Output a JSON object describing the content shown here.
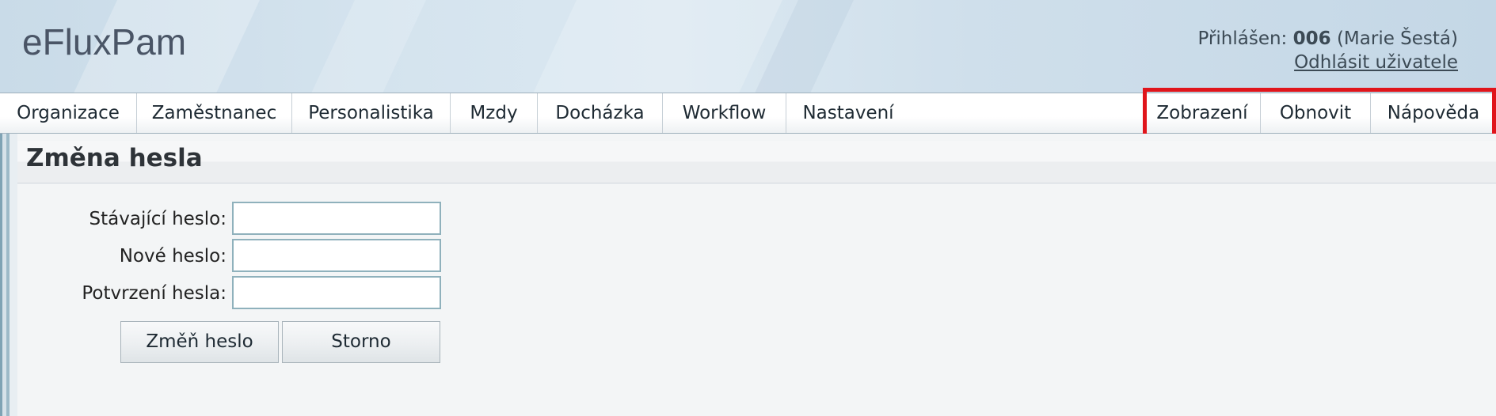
{
  "app": {
    "logo": "eFluxPam"
  },
  "user": {
    "prefix": "Přihlášen:",
    "code": "006",
    "name": "(Marie Šestá)",
    "logout_label": "Odhlásit uživatele"
  },
  "menu": {
    "left": [
      "Organizace",
      "Zaměstnanec",
      "Personalistika",
      "Mzdy",
      "Docházka",
      "Workflow",
      "Nastavení"
    ],
    "right": [
      "Zobrazení",
      "Obnovit",
      "Nápověda"
    ]
  },
  "page": {
    "title": "Změna hesla"
  },
  "form": {
    "current_password_label": "Stávající heslo:",
    "new_password_label": "Nové heslo:",
    "confirm_password_label": "Potvrzení hesla:",
    "current_password_value": "",
    "new_password_value": "",
    "confirm_password_value": "",
    "submit_label": "Změň heslo",
    "cancel_label": "Storno"
  },
  "colors": {
    "highlight": "#e0151b",
    "input_border": "#8fb1bc"
  }
}
